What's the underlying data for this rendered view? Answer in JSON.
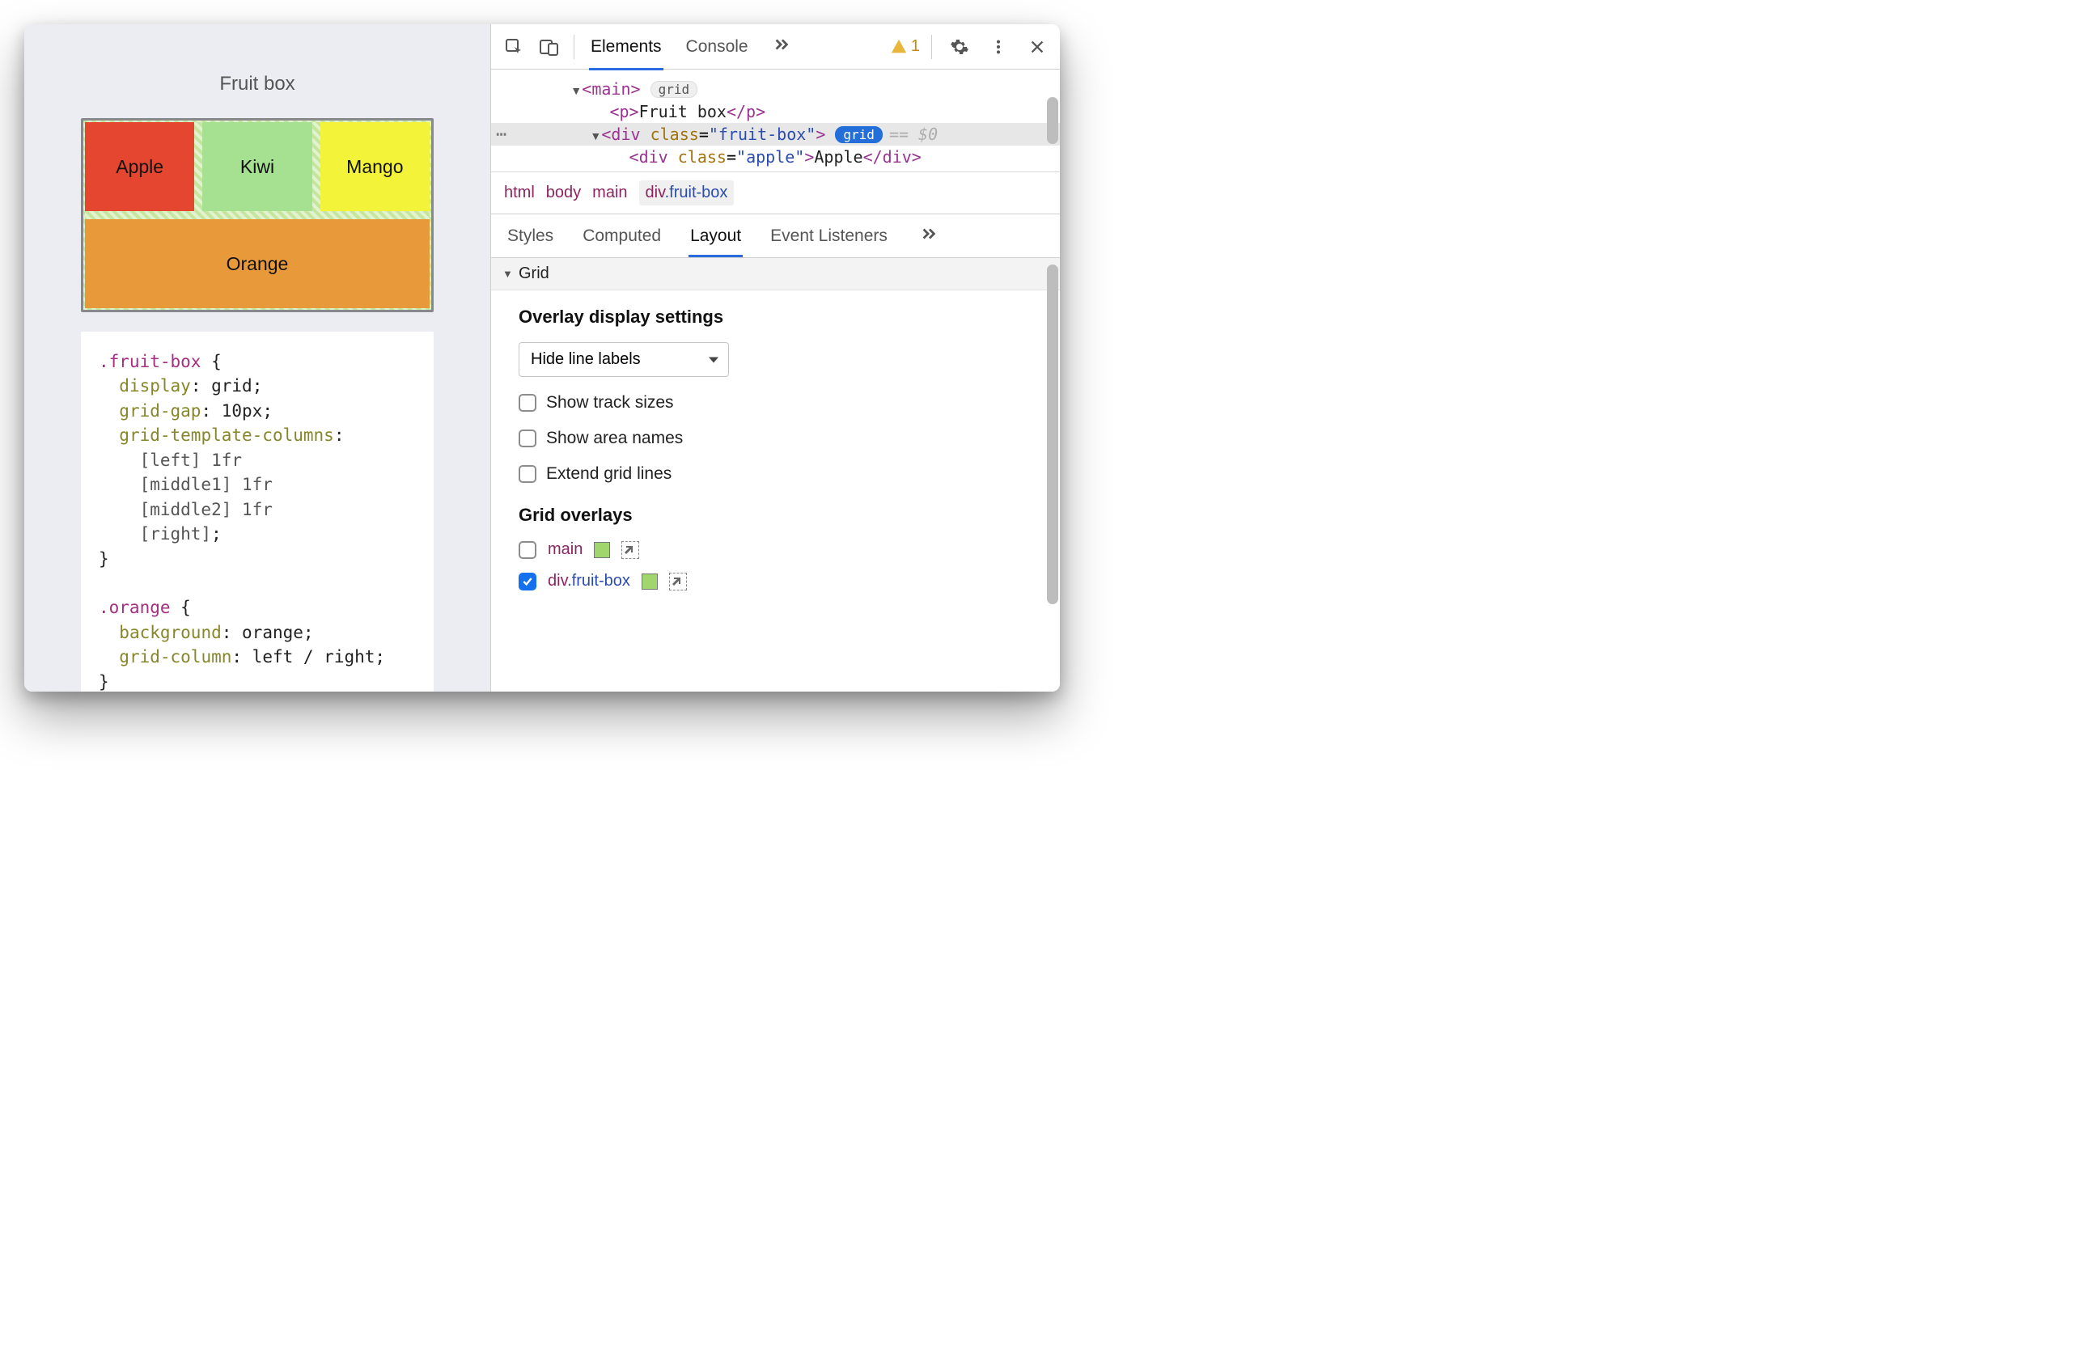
{
  "page": {
    "title": "Fruit box",
    "cells": {
      "apple": "Apple",
      "kiwi": "Kiwi",
      "mango": "Mango",
      "orange": "Orange"
    },
    "code": {
      "fruitbox_selector": ".fruit-box",
      "fruitbox_rules": {
        "display": "display",
        "display_val": "grid",
        "gridgap": "grid-gap",
        "gridgap_val": "10px",
        "gtc": "grid-template-columns",
        "line1": "[left] 1fr",
        "line2": "[middle1] 1fr",
        "line3": "[middle2] 1fr",
        "line4": "[right]"
      },
      "orange_selector": ".orange",
      "orange_rules": {
        "bg": "background",
        "bg_val": "orange",
        "gc": "grid-column",
        "gc_val": "left / right"
      }
    }
  },
  "devtools": {
    "tabs": {
      "elements": "Elements",
      "console": "Console"
    },
    "warn_count": "1",
    "dom": {
      "main_open": "<main>",
      "main_badge": "grid",
      "p_line": "<p>Fruit box</p>",
      "div_fb_open_a": "<div ",
      "div_fb_open_b": "class",
      "div_fb_open_c": "=",
      "div_fb_open_d": "\"fruit-box\"",
      "div_fb_open_e": ">",
      "div_fb_badge": "grid",
      "ghost": "== $0",
      "apple_line_a": "<div ",
      "apple_line_b": "class",
      "apple_line_c": "=",
      "apple_line_d": "\"apple\"",
      "apple_line_e": ">Apple</div>"
    },
    "breadcrumbs": {
      "b0": "html",
      "b1": "body",
      "b2": "main",
      "b3a": "div",
      "b3b": ".fruit-box"
    },
    "subtabs": {
      "styles": "Styles",
      "computed": "Computed",
      "layout": "Layout",
      "listeners": "Event Listeners"
    },
    "layout": {
      "grid_header": "Grid",
      "overlay_hdr": "Overlay display settings",
      "select_val": "Hide line labels",
      "cb1": "Show track sizes",
      "cb2": "Show area names",
      "cb3": "Extend grid lines",
      "overlays_hdr": "Grid overlays",
      "ov1": "main",
      "ov2a": "div",
      "ov2b": ".fruit-box"
    }
  }
}
